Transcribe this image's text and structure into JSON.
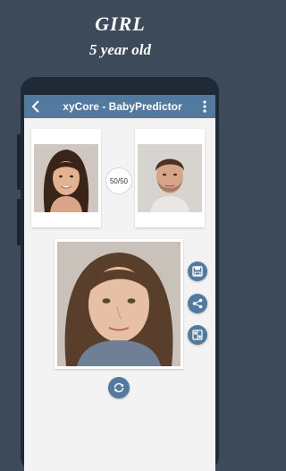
{
  "promo": {
    "gender": "GIRL",
    "age": "5 year old"
  },
  "appbar": {
    "title": "xyCore - BabyPredictor"
  },
  "ratio": "50/50",
  "colors": {
    "background": "#3c4a5a",
    "appbar": "#52799e",
    "screen": "#f3f3f3"
  },
  "icons": {
    "back": "arrow-left-icon",
    "menu": "more-vertical-icon",
    "save": "save-icon",
    "share": "share-icon",
    "compare": "compare-icon",
    "regenerate": "refresh-icon"
  }
}
